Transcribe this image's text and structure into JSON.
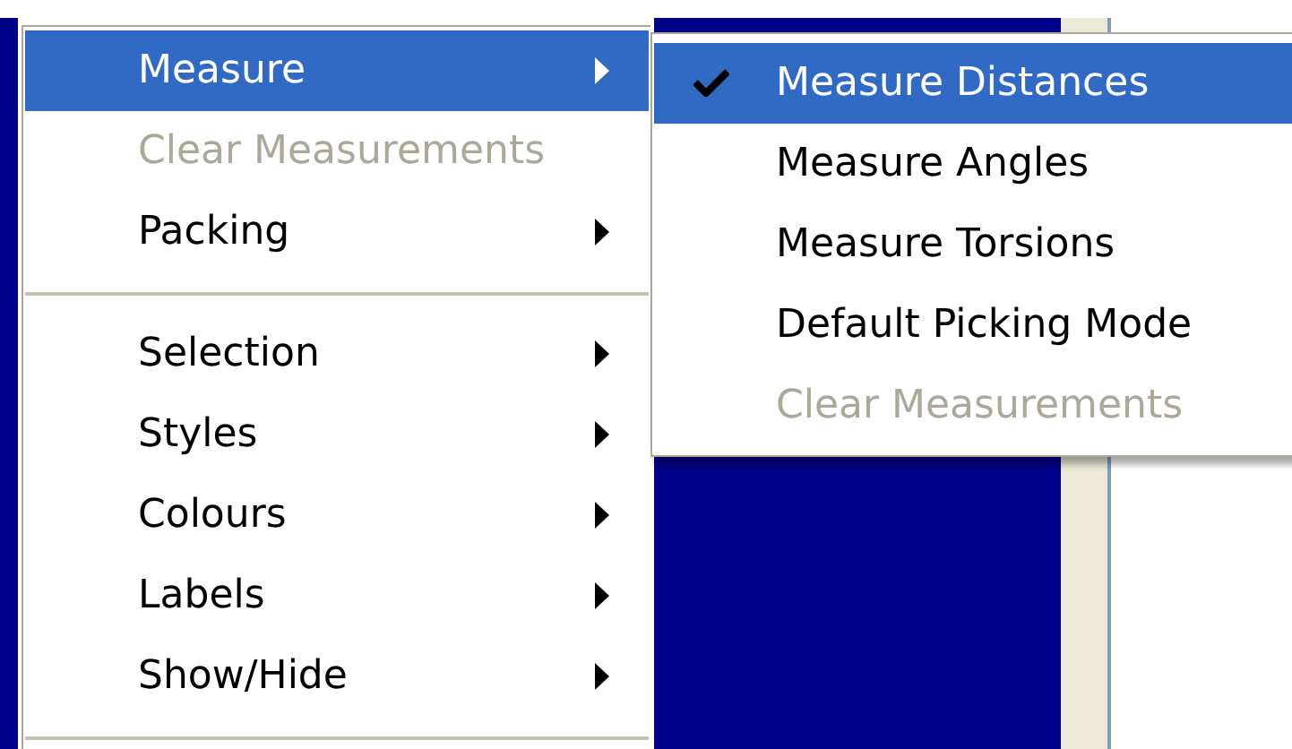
{
  "main_menu": {
    "items": [
      {
        "kind": "item",
        "label": "Measure",
        "selected": true,
        "disabled": false,
        "has_submenu": true
      },
      {
        "kind": "item",
        "label": "Clear Measurements",
        "selected": false,
        "disabled": true,
        "has_submenu": false
      },
      {
        "kind": "item",
        "label": "Packing",
        "selected": false,
        "disabled": false,
        "has_submenu": true
      },
      {
        "kind": "separator"
      },
      {
        "kind": "item",
        "label": "Selection",
        "selected": false,
        "disabled": false,
        "has_submenu": true
      },
      {
        "kind": "item",
        "label": "Styles",
        "selected": false,
        "disabled": false,
        "has_submenu": true
      },
      {
        "kind": "item",
        "label": "Colours",
        "selected": false,
        "disabled": false,
        "has_submenu": true
      },
      {
        "kind": "item",
        "label": "Labels",
        "selected": false,
        "disabled": false,
        "has_submenu": true
      },
      {
        "kind": "item",
        "label": "Show/Hide",
        "selected": false,
        "disabled": false,
        "has_submenu": true
      },
      {
        "kind": "separator"
      }
    ]
  },
  "submenu": {
    "items": [
      {
        "label": "Measure Distances",
        "checked": true,
        "selected": true,
        "disabled": false
      },
      {
        "label": "Measure Angles",
        "checked": false,
        "selected": false,
        "disabled": false
      },
      {
        "label": "Measure Torsions",
        "checked": false,
        "selected": false,
        "disabled": false
      },
      {
        "label": "Default Picking Mode",
        "checked": false,
        "selected": false,
        "disabled": false
      },
      {
        "label": "Clear Measurements",
        "checked": false,
        "selected": false,
        "disabled": true
      }
    ]
  }
}
